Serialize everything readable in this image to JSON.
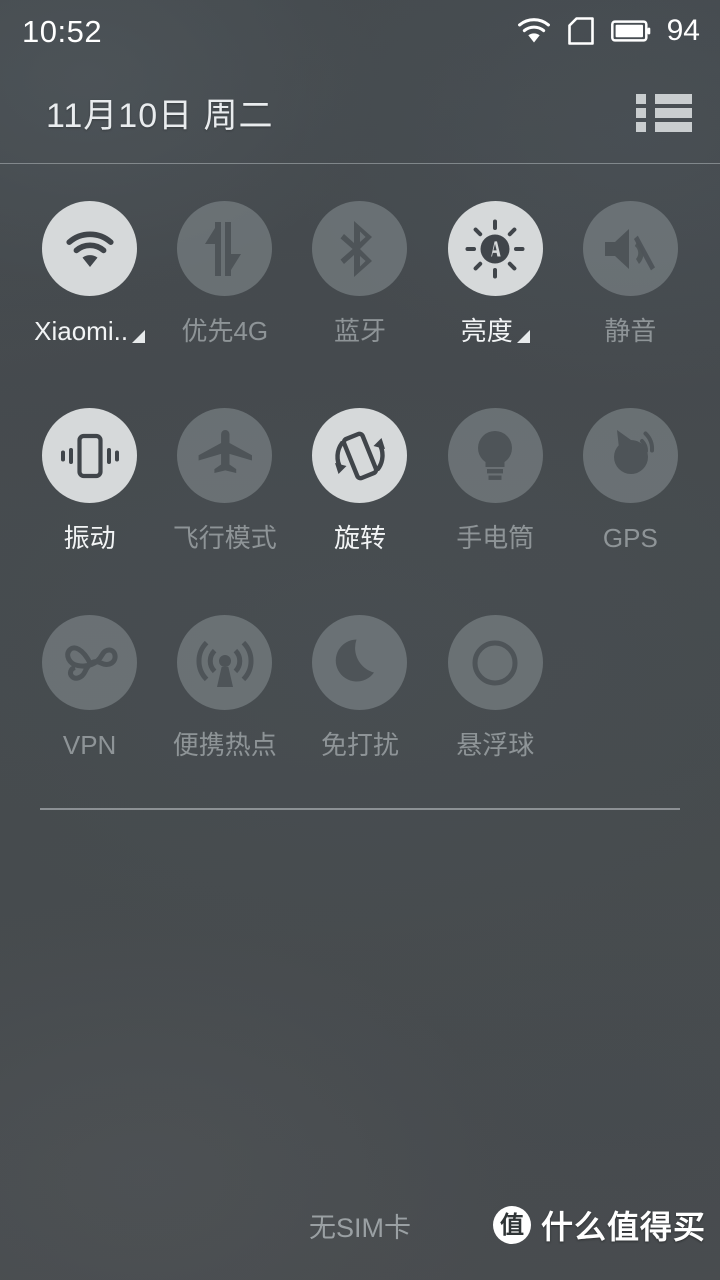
{
  "statusbar": {
    "clock": "10:52",
    "battery_percent": "94",
    "icons": [
      "wifi-icon",
      "sim-card-icon",
      "battery-icon"
    ]
  },
  "header": {
    "date": "11月10日  周二",
    "menu_icon": "list-menu-icon"
  },
  "tiles": [
    {
      "id": "wifi",
      "label": "Xiaomi..",
      "icon": "wifi-icon",
      "state": "on",
      "expandable": true
    },
    {
      "id": "data",
      "label": "优先4G",
      "icon": "data-arrows-icon",
      "state": "off",
      "expandable": false
    },
    {
      "id": "bluetooth",
      "label": "蓝牙",
      "icon": "bluetooth-icon",
      "state": "off",
      "expandable": false
    },
    {
      "id": "brightness",
      "label": "亮度",
      "icon": "brightness-auto-icon",
      "state": "on",
      "expandable": true
    },
    {
      "id": "mute",
      "label": "静音",
      "icon": "volume-mute-icon",
      "state": "off",
      "expandable": false
    },
    {
      "id": "vibrate",
      "label": "振动",
      "icon": "vibrate-icon",
      "state": "on",
      "expandable": false
    },
    {
      "id": "airplane",
      "label": "飞行模式",
      "icon": "airplane-icon",
      "state": "off",
      "expandable": false
    },
    {
      "id": "rotate",
      "label": "旋转",
      "icon": "screen-rotate-icon",
      "state": "on",
      "expandable": false
    },
    {
      "id": "flashlight",
      "label": "手电筒",
      "icon": "flashlight-bulb-icon",
      "state": "off",
      "expandable": false
    },
    {
      "id": "gps",
      "label": "GPS",
      "icon": "gps-icon",
      "state": "off",
      "expandable": false
    },
    {
      "id": "vpn",
      "label": "VPN",
      "icon": "vpn-key-icon",
      "state": "off",
      "expandable": false
    },
    {
      "id": "hotspot",
      "label": "便携热点",
      "icon": "hotspot-icon",
      "state": "off",
      "expandable": false
    },
    {
      "id": "dnd",
      "label": "免打扰",
      "icon": "moon-icon",
      "state": "off",
      "expandable": false
    },
    {
      "id": "floatball",
      "label": "悬浮球",
      "icon": "ring-icon",
      "state": "off",
      "expandable": false
    }
  ],
  "bottom": {
    "sim_status": "无SIM卡",
    "watermark_logo": "值",
    "watermark_text": "什么值得买"
  },
  "colors": {
    "background": "#4a4f53",
    "tile_on_circle": "#d6d9da",
    "tile_off_circle": "#80878a",
    "label_on": "#f2f4f5",
    "label_off": "#8e9497",
    "status_text": "#ffffff"
  }
}
